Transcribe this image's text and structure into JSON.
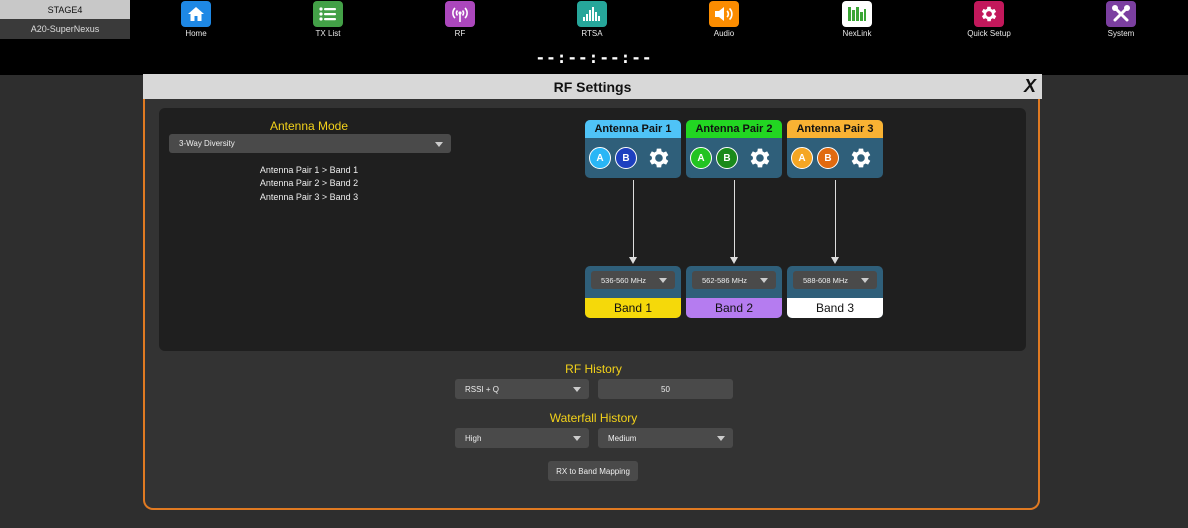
{
  "device": {
    "stage": "STAGE4",
    "name": "A20-SuperNexus"
  },
  "nav": [
    {
      "label": "Home",
      "icon": "home-icon",
      "color": "#1e88e5"
    },
    {
      "label": "TX List",
      "icon": "list-icon",
      "color": "#43a047"
    },
    {
      "label": "RF",
      "icon": "antenna-icon",
      "color": "#ab47bc"
    },
    {
      "label": "RTSA",
      "icon": "spectrum-icon",
      "color": "#26a69a"
    },
    {
      "label": "Audio",
      "icon": "speaker-icon",
      "color": "#fb8c00"
    },
    {
      "label": "NexLink",
      "icon": "nexlink-icon",
      "color": "#43a047"
    },
    {
      "label": "Quick Setup",
      "icon": "gear-icon",
      "color": "#c2185b"
    },
    {
      "label": "System",
      "icon": "tools-icon",
      "color": "#7b3fa0"
    }
  ],
  "timecode": "--:--:--:--",
  "modal": {
    "title": "RF Settings",
    "close_label": "X",
    "accent_color": "#e07a22",
    "antenna_mode": {
      "title": "Antenna Mode",
      "selected": "3-Way Diversity",
      "mapping": [
        "Antenna Pair 1 > Band 1",
        "Antenna Pair 2 > Band 2",
        "Antenna Pair 3 > Band 3"
      ]
    },
    "pairs": [
      {
        "label": "Antenna Pair 1",
        "color": "#4fc3f7",
        "a_color": "#29b6f6",
        "b_color": "#1e40c0",
        "a": "A",
        "b": "B"
      },
      {
        "label": "Antenna Pair 2",
        "color": "#22d622",
        "a_color": "#22c322",
        "b_color": "#1a8a1a",
        "a": "A",
        "b": "B"
      },
      {
        "label": "Antenna Pair 3",
        "color": "#f9b233",
        "a_color": "#f5a623",
        "b_color": "#e06a10",
        "a": "A",
        "b": "B"
      }
    ],
    "bands": [
      {
        "freq": "536-560 MHz",
        "label": "Band 1",
        "color": "#f5d90a"
      },
      {
        "freq": "562-586 MHz",
        "label": "Band 2",
        "color": "#b57cf0"
      },
      {
        "freq": "588-608 MHz",
        "label": "Band 3",
        "color": "#ffffff"
      }
    ],
    "rf_history": {
      "title": "RF History",
      "mode": "RSSI + Q",
      "value": "50"
    },
    "waterfall_history": {
      "title": "Waterfall History",
      "speed": "High",
      "level": "Medium"
    },
    "mapping_button": "RX to Band Mapping"
  }
}
